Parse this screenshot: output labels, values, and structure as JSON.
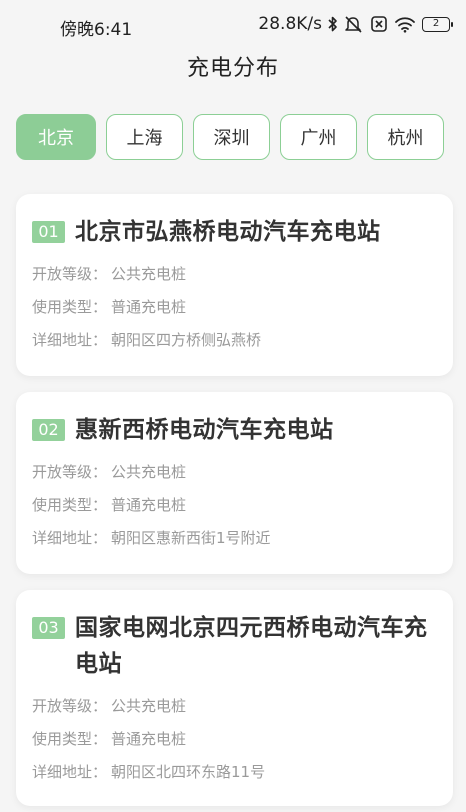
{
  "status_bar": {
    "time": "傍晚6:41",
    "network_speed": "28.8K/s",
    "battery_level": "2",
    "icons": [
      "bluetooth-icon",
      "mute-icon",
      "sim-off-icon",
      "wifi-icon",
      "battery-icon"
    ]
  },
  "header": {
    "title": "充电分布"
  },
  "tabs": [
    {
      "label": "北京",
      "active": true
    },
    {
      "label": "上海",
      "active": false
    },
    {
      "label": "深圳",
      "active": false
    },
    {
      "label": "广州",
      "active": false
    },
    {
      "label": "杭州",
      "active": false
    }
  ],
  "stations": [
    {
      "index": "01",
      "name": "北京市弘燕桥电动汽车充电站",
      "open_level_label": "开放等级：",
      "open_level": "公共充电桩",
      "use_type_label": "使用类型：",
      "use_type": "普通充电桩",
      "address_label": "详细地址：",
      "address": "朝阳区四方桥侧弘燕桥"
    },
    {
      "index": "02",
      "name": "惠新西桥电动汽车充电站",
      "open_level_label": "开放等级：",
      "open_level": "公共充电桩",
      "use_type_label": "使用类型：",
      "use_type": "普通充电桩",
      "address_label": "详细地址：",
      "address": "朝阳区惠新西街1号附近"
    },
    {
      "index": "03",
      "name": "国家电网北京四元西桥电动汽车充电站",
      "open_level_label": "开放等级：",
      "open_level": "公共充电桩",
      "use_type_label": "使用类型：",
      "use_type": "普通充电桩",
      "address_label": "详细地址：",
      "address": "朝阳区北四环东路11号"
    }
  ],
  "colors": {
    "accent": "#8dcd96",
    "background": "#f5f5f5",
    "card": "#ffffff",
    "secondary_text": "#9a9a9a"
  }
}
